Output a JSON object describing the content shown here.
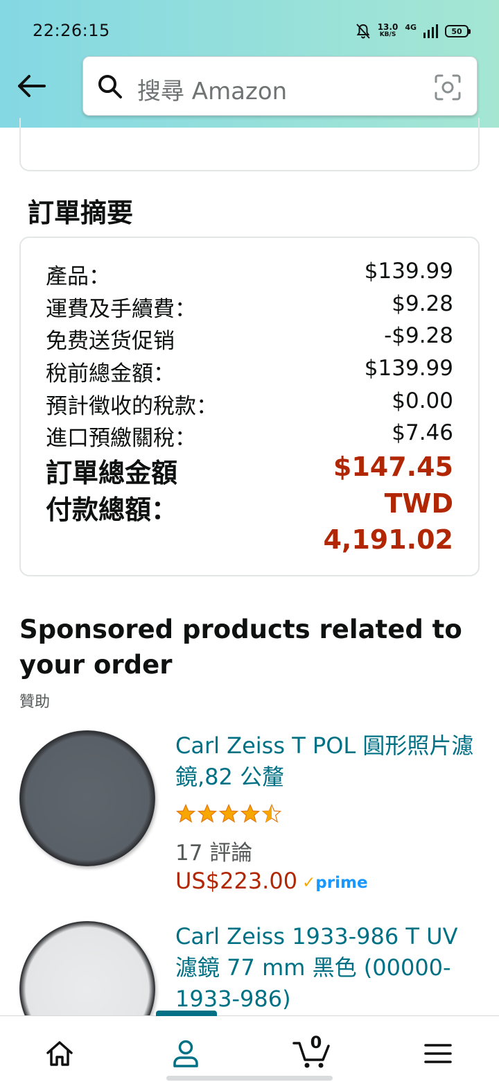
{
  "status_bar": {
    "time": "22:26:15",
    "speed": "13.0",
    "speed_unit": "KB/S",
    "network": "4G",
    "battery": "50"
  },
  "header": {
    "search_placeholder": "搜尋 Amazon"
  },
  "order_summary": {
    "title": "訂單摘要",
    "rows": [
      {
        "label": "產品：",
        "value": "$139.99"
      },
      {
        "label": "運費及手續費：",
        "value": "$9.28"
      },
      {
        "label": "免费送货促销",
        "value": "-$9.28"
      },
      {
        "label": "稅前總金額：",
        "value": "$139.99"
      },
      {
        "label": "預計徵收的稅款：",
        "value": "$0.00"
      },
      {
        "label": "進口預繳關稅：",
        "value": "$7.46"
      }
    ],
    "order_total_label": "訂單總金額",
    "order_total_value": "$147.45",
    "payment_total_label": "付款總額：",
    "payment_currency": "TWD",
    "payment_total_value": "4,191.02"
  },
  "sponsored": {
    "title": "Sponsored products related to your order",
    "subtitle": "贊助",
    "products": [
      {
        "title": "Carl Zeiss T POL 圓形照片濾鏡,82 公釐",
        "rating": 4.5,
        "reviews": "17 評論",
        "price": "US$223.00",
        "prime_label": "prime"
      },
      {
        "title": "Carl Zeiss 1933-986 T UV 濾鏡 77 mm 黑色 (00000-1933-986)"
      }
    ]
  },
  "bottom_nav": {
    "cart_count": "0"
  },
  "colors": {
    "accent": "#007185",
    "price": "#b12704",
    "star": "#f7a700",
    "header_start": "#84d8e3",
    "header_end": "#a5e6d3"
  }
}
